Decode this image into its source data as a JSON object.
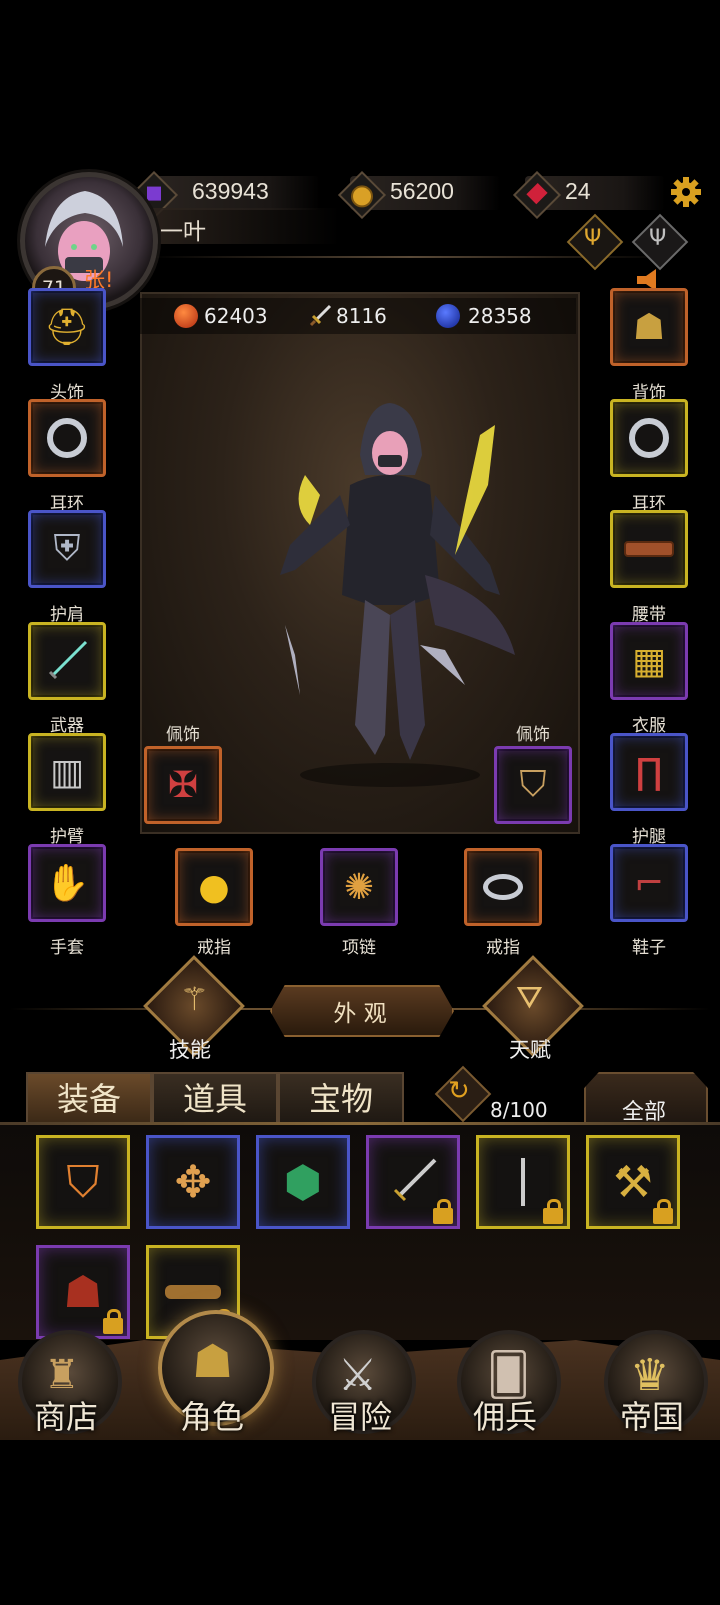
{
  "top_bar": {
    "purple_crystal": "639943",
    "gold": "56200",
    "red_gem": "24",
    "player_name": "一叶",
    "level": "71",
    "notice": "张!"
  },
  "stats": {
    "hp": "62403",
    "attack": "8116",
    "mana": "28358"
  },
  "left_slots": [
    {
      "label": "头饰"
    },
    {
      "label": "耳环"
    },
    {
      "label": "护肩"
    },
    {
      "label": "武器"
    },
    {
      "label": "护臂"
    },
    {
      "label": "手套"
    }
  ],
  "right_slots": [
    {
      "label": "背饰"
    },
    {
      "label": "耳环"
    },
    {
      "label": "腰带"
    },
    {
      "label": "衣服"
    },
    {
      "label": "护腿"
    },
    {
      "label": "鞋子"
    }
  ],
  "charm_left_label": "佩饰",
  "charm_right_label": "佩饰",
  "bottom_slots": [
    {
      "label": "戒指"
    },
    {
      "label": "项链"
    },
    {
      "label": "戒指"
    }
  ],
  "actions": {
    "skills": "技能",
    "appearance": "外 观",
    "talent": "天赋"
  },
  "inventory": {
    "tabs": [
      "装备",
      "道具",
      "宝物"
    ],
    "count": "8/100",
    "filter": "全部"
  },
  "nav": {
    "shop": "商店",
    "character": "角色",
    "adventure": "冒险",
    "mercenary": "佣兵",
    "empire": "帝国"
  }
}
